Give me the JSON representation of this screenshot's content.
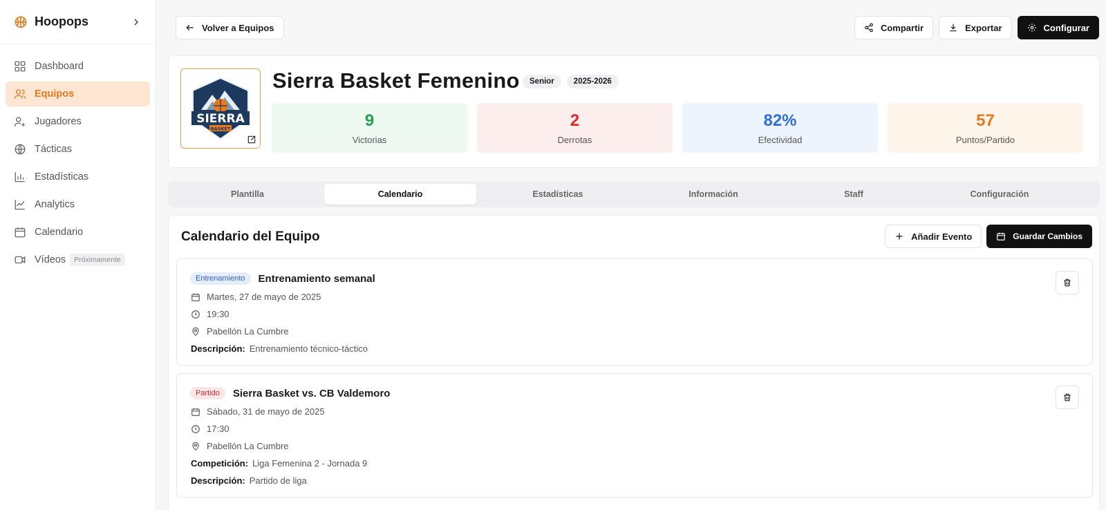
{
  "app": {
    "name": "Hoopops",
    "brand_color": "#e07a1f"
  },
  "sidebar": {
    "items": [
      {
        "label": "Dashboard",
        "icon": "grid-icon"
      },
      {
        "label": "Equipos",
        "icon": "users-icon",
        "active": true
      },
      {
        "label": "Jugadores",
        "icon": "user-plus-icon"
      },
      {
        "label": "Tácticas",
        "icon": "globe-icon"
      },
      {
        "label": "Estadísticas",
        "icon": "bar-chart-icon"
      },
      {
        "label": "Analytics",
        "icon": "line-chart-icon"
      },
      {
        "label": "Calendario",
        "icon": "calendar-icon"
      },
      {
        "label": "Vídeos",
        "icon": "video-icon",
        "badge": "Próximamente"
      }
    ]
  },
  "header": {
    "back_label": "Volver a Equipos",
    "share_label": "Compartir",
    "export_label": "Exportar",
    "configure_label": "Configurar"
  },
  "team": {
    "name": "Sierra Basket Femenino",
    "logo_text": "SIERRA",
    "logo_subtext": "BASKET",
    "tags": [
      "Senior",
      "2025-2026"
    ],
    "stats": [
      {
        "value": "9",
        "label": "Victorias",
        "color": "#22a24f"
      },
      {
        "value": "2",
        "label": "Derrotas",
        "color": "#dc2a2a"
      },
      {
        "value": "82%",
        "label": "Efectividad",
        "color": "#2f6fd6"
      },
      {
        "value": "57",
        "label": "Puntos/Partido",
        "color": "#e8791d"
      }
    ]
  },
  "tabs": [
    {
      "label": "Plantilla"
    },
    {
      "label": "Calendario",
      "active": true
    },
    {
      "label": "Estadísticas"
    },
    {
      "label": "Información"
    },
    {
      "label": "Staff"
    },
    {
      "label": "Configuración"
    }
  ],
  "calendar": {
    "title": "Calendario del Equipo",
    "add_label": "Añadir Evento",
    "save_label": "Guardar Cambios",
    "events": [
      {
        "type": "Entrenamiento",
        "title": "Entrenamiento semanal",
        "date": "Martes, 27 de mayo de 2025",
        "time": "19:30",
        "location": "Pabellón La Cumbre",
        "description_label": "Descripción:",
        "description": "Entrenamiento técnico-táctico"
      },
      {
        "type": "Partido",
        "title": "Sierra Basket vs. CB Valdemoro",
        "date": "Sábado, 31 de mayo de 2025",
        "time": "17:30",
        "location": "Pabellón La Cumbre",
        "competition_label": "Competición:",
        "competition": "Liga Femenina 2 - Jornada 9",
        "description_label": "Descripción:",
        "description": "Partido de liga"
      }
    ]
  }
}
